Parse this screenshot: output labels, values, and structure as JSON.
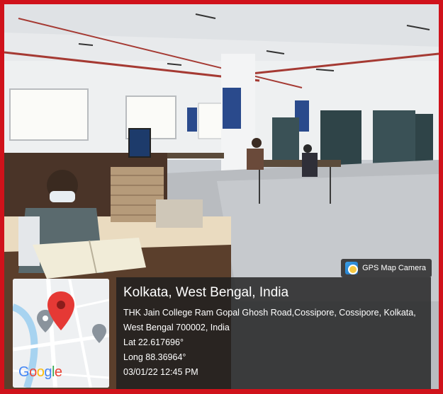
{
  "badge": {
    "icon": "gps-map-camera-icon",
    "label": "GPS Map Camera"
  },
  "location": {
    "city": "Kolkata, West Bengal, India",
    "address_line1": "THK Jain College Ram Gopal Ghosh Road,Cossipore, Cossipore, Kolkata,",
    "address_line2": "West Bengal 700002, India",
    "lat": "Lat 22.617696°",
    "long": "Long 88.36964°",
    "datetime": "03/01/22 12:45 PM"
  },
  "map": {
    "logo_text": "Google",
    "pin_icon": "map-pin-icon",
    "pin_color": "#e53935"
  },
  "colors": {
    "border": "#d0121b",
    "panel": "#1e1e1e"
  }
}
